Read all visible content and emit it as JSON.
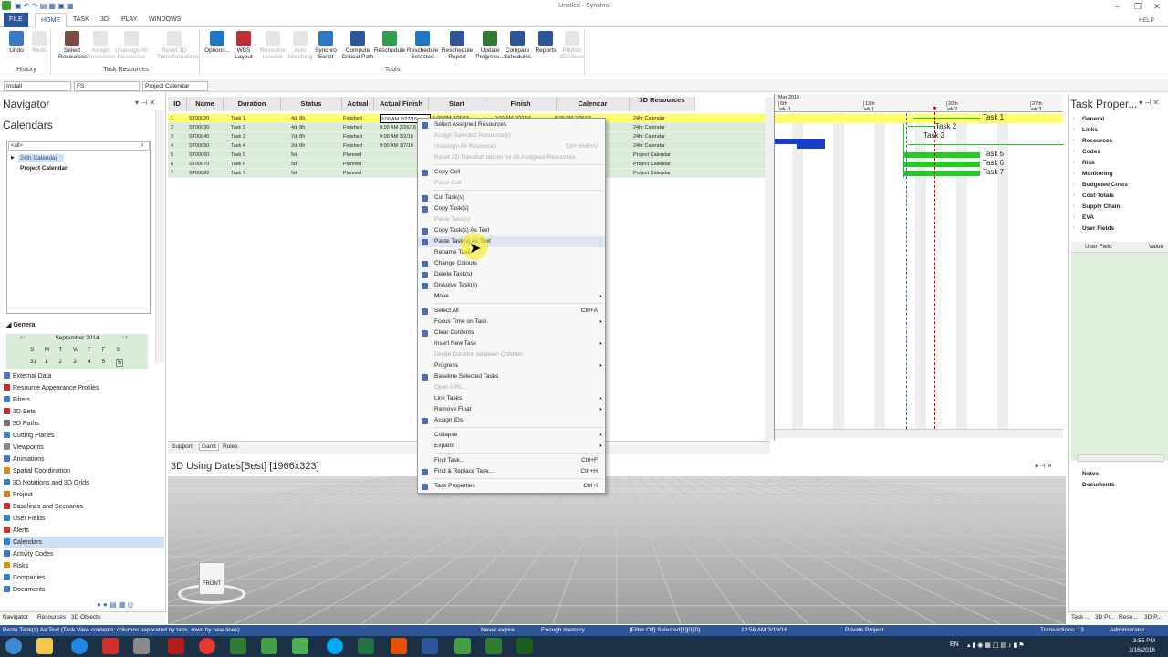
{
  "app": {
    "title": "Untitled - Synchro",
    "help": "HELP"
  },
  "menu": [
    "FILE",
    "HOME",
    "TASK",
    "3D",
    "PLAY",
    "WINDOWS"
  ],
  "ribbon": {
    "buttons": [
      {
        "label": "Undo",
        "icon": "undo-icon",
        "enabled": true
      },
      {
        "label": "Redo",
        "icon": "redo-icon",
        "enabled": false
      },
      {
        "label": "Select Resources",
        "icon": "select-resources-icon",
        "enabled": true
      },
      {
        "label": "Assign Resources",
        "icon": "assign-resources-icon",
        "enabled": false
      },
      {
        "label": "Unassign All Resources",
        "icon": "unassign-resources-icon",
        "enabled": false
      },
      {
        "label": "Reset 3D Transformations",
        "icon": "reset-3d-icon",
        "enabled": false
      },
      {
        "label": "Options...",
        "icon": "gear-icon",
        "enabled": true
      },
      {
        "label": "WBS Layout",
        "icon": "wbs-icon",
        "enabled": true
      },
      {
        "label": "Resource Leveller",
        "icon": "leveller-icon",
        "enabled": false
      },
      {
        "label": "Auto Matching",
        "icon": "matching-icon",
        "enabled": false
      },
      {
        "label": "Synchro Script",
        "icon": "script-icon",
        "enabled": true
      },
      {
        "label": "Compute Critical Path",
        "icon": "critical-path-icon",
        "enabled": true
      },
      {
        "label": "Reschedule",
        "icon": "reschedule-icon",
        "enabled": true
      },
      {
        "label": "Reschedule Selected",
        "icon": "reschedule-selected-icon",
        "enabled": true
      },
      {
        "label": "Reschedule Report",
        "icon": "report-icon",
        "enabled": true
      },
      {
        "label": "Update Progress...",
        "icon": "progress-icon",
        "enabled": true
      },
      {
        "label": "Compare Schedules",
        "icon": "compare-icon",
        "enabled": true
      },
      {
        "label": "Reports",
        "icon": "reports-icon",
        "enabled": true
      },
      {
        "label": "Publish 3D Views",
        "icon": "publish-icon",
        "enabled": false
      }
    ],
    "groups": {
      "history": "History",
      "task_resources": "Task Resources",
      "tools": "Tools"
    }
  },
  "filters": {
    "one": "Install",
    "two": "FS",
    "three": "Project Calendar"
  },
  "navigator": {
    "title": "Navigator",
    "section": "Calendars",
    "search_placeholder": "<all>",
    "calendars": [
      "24th Calendar",
      "Project Calendar"
    ],
    "general": "General",
    "month": "September 2014",
    "weekdays": [
      "S",
      "M",
      "T",
      "W",
      "T",
      "F",
      "S"
    ],
    "days": [
      "31",
      "1",
      "2",
      "3",
      "4",
      "5",
      "6"
    ],
    "items": [
      {
        "label": "External Data",
        "color": "#4a78b8"
      },
      {
        "label": "Resource Appearance Profiles",
        "color": "#c03030"
      },
      {
        "label": "Filters",
        "color": "#3a7fc4"
      },
      {
        "label": "3D Sets",
        "color": "#c03030"
      },
      {
        "label": "3D Paths",
        "color": "#777"
      },
      {
        "label": "Cutting Planes",
        "color": "#3a7fc4"
      },
      {
        "label": "Viewpoints",
        "color": "#888"
      },
      {
        "label": "Animations",
        "color": "#4a78b8"
      },
      {
        "label": "Spatial Coordination",
        "color": "#d09020"
      },
      {
        "label": "3D Notations and 3D Grids",
        "color": "#3a7fc4"
      },
      {
        "label": "Project",
        "color": "#d08020"
      },
      {
        "label": "Baselines and Scenarios",
        "color": "#c03030"
      },
      {
        "label": "User Fields",
        "color": "#3a7fc4"
      },
      {
        "label": "Alerts",
        "color": "#d03030"
      },
      {
        "label": "Calendars",
        "color": "#3a7fc4"
      },
      {
        "label": "Activity Codes",
        "color": "#3a7fc4"
      },
      {
        "label": "Risks",
        "color": "#d09020"
      },
      {
        "label": "Companies",
        "color": "#3a7fc4"
      },
      {
        "label": "Documents",
        "color": "#3a7fc4"
      }
    ],
    "tabs": [
      "Navigator",
      "Resources",
      "3D Objects"
    ]
  },
  "grid": {
    "columns": [
      "ID",
      "Name",
      "Duration",
      "Status",
      "Actual Start",
      "Actual Finish",
      "Start",
      "Finish",
      "Calendar",
      "3D Resources"
    ],
    "rows": [
      {
        "n": "1",
        "id": "ST00020",
        "name": "Task 1",
        "dur": "4d, 8h",
        "status": "Finished",
        "as": "9:00 AM 2/22/16",
        "af": "5:00 PM 2/26/16",
        "st": "9:00 AM 2/22/16",
        "fi": "5:00 PM 2/26/16",
        "cal": "24hr Calendar"
      },
      {
        "n": "2",
        "id": "ST00030",
        "name": "Task 2",
        "dur": "4d, 8h",
        "status": "Finished",
        "as": "9:00 AM 2/26/16",
        "af": "",
        "st": "",
        "fi": "",
        "cal": "24hr Calendar"
      },
      {
        "n": "3",
        "id": "ST00040",
        "name": "Task 3",
        "dur": "7d, 8h",
        "status": "Finished",
        "as": "9:00 AM 3/2/16",
        "af": "",
        "st": "",
        "fi": "",
        "cal": "24hr Calendar"
      },
      {
        "n": "4",
        "id": "ST00050",
        "name": "Task 4",
        "dur": "2d, 8h",
        "status": "Finished",
        "as": "9:00 AM 3/7/16",
        "af": "",
        "st": "",
        "fi": "",
        "cal": "24hr Calendar"
      },
      {
        "n": "5",
        "id": "ST00060",
        "name": "Task 5",
        "dur": "5d",
        "status": "Planned",
        "as": "",
        "af": "",
        "st": "",
        "fi": "",
        "cal": "Project Calendar"
      },
      {
        "n": "6",
        "id": "ST00070",
        "name": "Task 6",
        "dur": "5d",
        "status": "Planned",
        "as": "",
        "af": "",
        "st": "",
        "fi": "",
        "cal": "Project Calendar"
      },
      {
        "n": "7",
        "id": "ST00080",
        "name": "Task 7",
        "dur": "5d",
        "status": "Planned",
        "as": "",
        "af": "",
        "st": "",
        "fi": "",
        "cal": "Project Calendar"
      }
    ],
    "bottom_tabs": [
      "Support",
      "Gantt",
      "Rules"
    ]
  },
  "gantt": {
    "month": "Mar 2016",
    "weeks": [
      "6th",
      "13th",
      "20th",
      "27th"
    ],
    "subweeks": [
      "wk -1",
      "wk 1",
      "wk 2",
      "wk 3"
    ],
    "labels": [
      "Task 1",
      "Task 2",
      "Task 3",
      "Task 5",
      "Task 6",
      "Task 7"
    ],
    "colors": {
      "finished": "#1a3cc8",
      "planned": "#22cc22",
      "today": "#cc0000"
    }
  },
  "context_menu": [
    {
      "label": "Select Assigned Resources",
      "enabled": true,
      "icon": "resources-icon"
    },
    {
      "label": "Assign Selected Resource(s)",
      "enabled": false
    },
    {
      "label": "Unassign All Resources",
      "enabled": false,
      "shortcut": "Ctrl+Shift+U"
    },
    {
      "label": "Reset 3D Transformations for All Assigned Resources",
      "enabled": false
    },
    {
      "sep": true
    },
    {
      "label": "Copy Cell",
      "enabled": true,
      "icon": "copy-icon"
    },
    {
      "label": "Paste Cell",
      "enabled": false
    },
    {
      "sep": true
    },
    {
      "label": "Cut Task(s)",
      "enabled": true,
      "icon": "cut-icon"
    },
    {
      "label": "Copy Task(s)",
      "enabled": true,
      "icon": "copy-icon"
    },
    {
      "label": "Paste Task(s)",
      "enabled": false
    },
    {
      "label": "Copy Task(s) As Text",
      "enabled": true,
      "icon": "copy-text-icon"
    },
    {
      "label": "Paste Task(s) As Text",
      "enabled": true,
      "icon": "paste-text-icon",
      "highlight": true
    },
    {
      "label": "Rename Task",
      "enabled": true
    },
    {
      "label": "Change Colours",
      "enabled": true,
      "icon": "palette-icon"
    },
    {
      "label": "Delete Task(s)",
      "enabled": true,
      "icon": "delete-icon"
    },
    {
      "label": "Dissolve Task(s)",
      "enabled": true,
      "icon": "dissolve-icon"
    },
    {
      "label": "Move",
      "enabled": true,
      "sub": true
    },
    {
      "sep": true
    },
    {
      "label": "Select All",
      "enabled": true,
      "shortcut": "Ctrl+A",
      "icon": "select-all-icon"
    },
    {
      "label": "Focus Time on Task",
      "enabled": true,
      "sub": true
    },
    {
      "label": "Clear Contents",
      "enabled": true,
      "icon": "clear-icon"
    },
    {
      "label": "Insert New Task",
      "enabled": true,
      "sub": true
    },
    {
      "label": "Divide Duration between Children",
      "enabled": false
    },
    {
      "label": "Progress",
      "enabled": true,
      "sub": true
    },
    {
      "label": "Baseline Selected Tasks",
      "enabled": true,
      "icon": "baseline-icon"
    },
    {
      "label": "Open URL...",
      "enabled": false
    },
    {
      "label": "Link Tasks",
      "enabled": true,
      "sub": true
    },
    {
      "label": "Remove Float",
      "enabled": true,
      "sub": true
    },
    {
      "label": "Assign IDs",
      "enabled": true,
      "icon": "id-icon"
    },
    {
      "sep": true
    },
    {
      "label": "Collapse",
      "enabled": true,
      "sub": true
    },
    {
      "label": "Expand",
      "enabled": true,
      "sub": true
    },
    {
      "sep": true
    },
    {
      "label": "Find Task...",
      "enabled": true,
      "shortcut": "Ctrl+F"
    },
    {
      "label": "Find & Replace Task...",
      "enabled": true,
      "shortcut": "Ctrl+H",
      "icon": "replace-icon"
    },
    {
      "sep": true
    },
    {
      "label": "Task Properties",
      "enabled": true,
      "shortcut": "Ctrl+I",
      "icon": "properties-icon"
    }
  ],
  "view3d": {
    "title": "3D Using Dates[Best] [1966x323]",
    "cube_label": "FRONT"
  },
  "properties": {
    "title": "Task Proper...",
    "items": [
      "General",
      "Links",
      "Resources",
      "Codes",
      "Risk",
      "Monitoring",
      "Budgeted Costs",
      "Cost Totals",
      "Supply Chain",
      "EVA",
      "User Fields"
    ],
    "cols": [
      "User Field",
      "Value"
    ],
    "lower": [
      "Notes",
      "Documents"
    ],
    "tabs": [
      "Task ...",
      "3D Pr...",
      "Reso...",
      "3D P..."
    ]
  },
  "status": {
    "hint": "Paste Task(s) As Text (Task View contents: columns separated by tabs, rows by new lines)",
    "expire": "Never expire",
    "memory": "Enough memory",
    "filter": "[Filter Off]  Selected[1][0][0]",
    "datetime": "12:56 AM 3/19/16",
    "project": "Private Project",
    "transactions": "Transactions: 13",
    "user": "Administrator"
  },
  "taskbar": {
    "lang": "EN",
    "time": "3:55 PM",
    "date": "3/16/2016"
  }
}
